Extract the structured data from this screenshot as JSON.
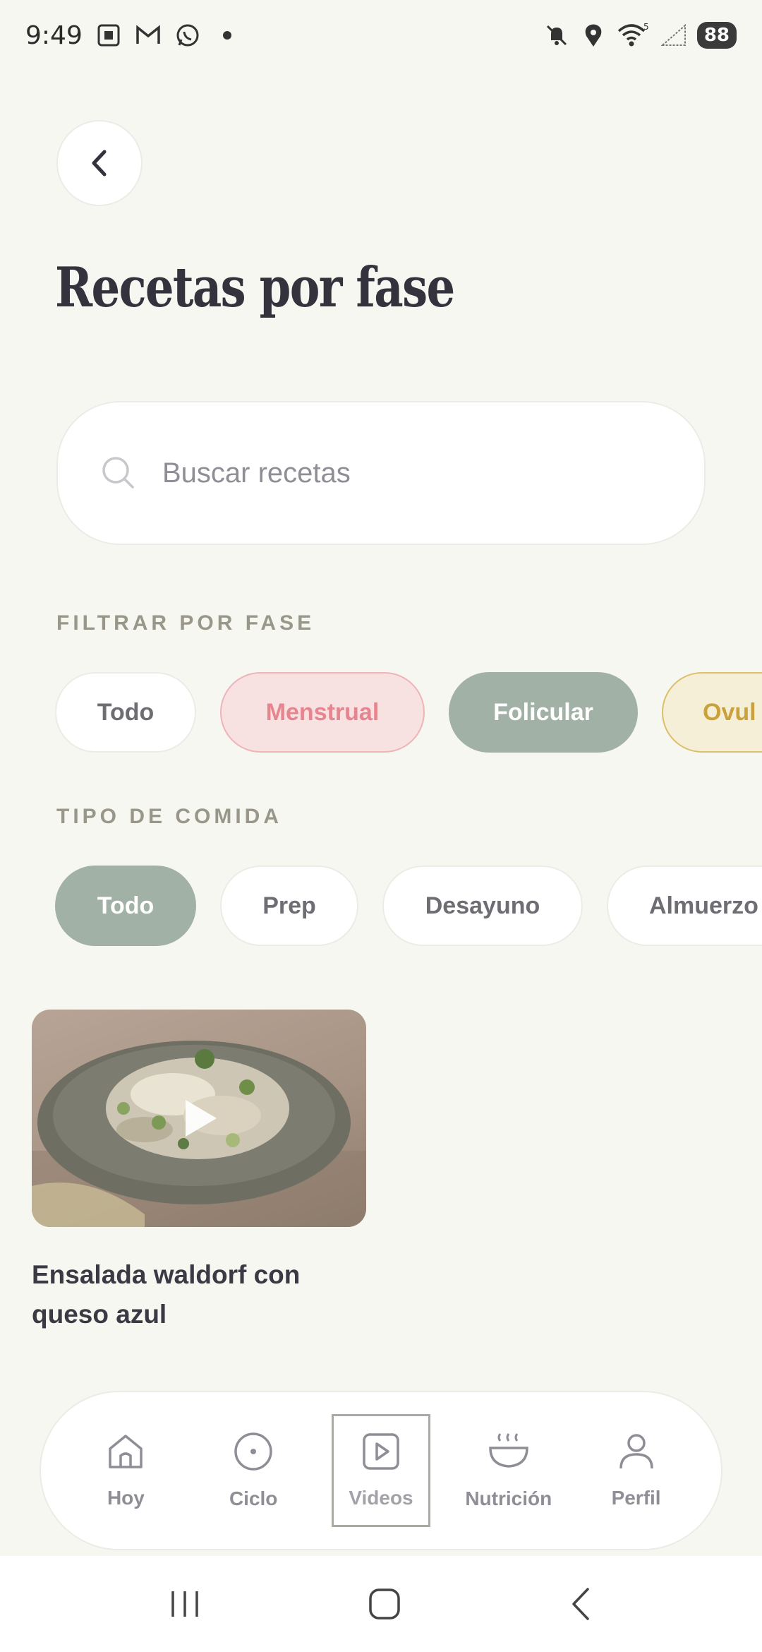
{
  "status_bar": {
    "time": "9:49",
    "battery": "88",
    "network_badge": "5"
  },
  "header": {
    "title": "Recetas por fase"
  },
  "search": {
    "placeholder": "Buscar recetas"
  },
  "phase_filter": {
    "label": "FILTRAR POR FASE",
    "chips": [
      "Todo",
      "Menstrual",
      "Folicular",
      "Ovul"
    ],
    "selected": "Folicular",
    "colors": {
      "menstrual": "#e4858f",
      "folicular": "#a2b1a6",
      "ovulatoria": "#c9a23b"
    }
  },
  "meal_filter": {
    "label": "TIPO DE COMIDA",
    "chips": [
      "Todo",
      "Prep",
      "Desayuno",
      "Almuerzo"
    ],
    "selected": "Todo"
  },
  "recipes": [
    {
      "title_line1": "Ensalada waldorf con",
      "title_line2": "queso azul",
      "icon": "play-icon"
    }
  ],
  "bottom_nav": {
    "items": [
      {
        "label": "Hoy",
        "icon": "home-icon"
      },
      {
        "label": "Ciclo",
        "icon": "circle-icon"
      },
      {
        "label": "Videos",
        "icon": "video-icon"
      },
      {
        "label": "Nutrición",
        "icon": "bowl-icon"
      },
      {
        "label": "Perfil",
        "icon": "user-icon"
      }
    ],
    "selected": "Videos"
  }
}
